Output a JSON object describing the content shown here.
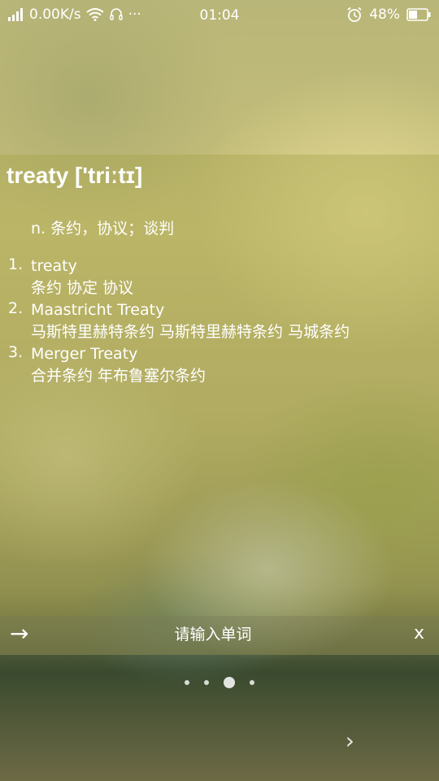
{
  "status_bar": {
    "network_speed": "0.00K/s",
    "more": "···",
    "time": "01:04",
    "battery": "48%"
  },
  "dictionary": {
    "headword": "treaty ['triːtɪ]",
    "definition": "n. 条约，协议；谈判",
    "phrases": [
      {
        "number": "1.",
        "term": "treaty",
        "translation": "条约 协定 协议"
      },
      {
        "number": "2.",
        "term": "Maastricht Treaty",
        "translation": "马斯特里赫特条约 马斯特里赫特条约 马城条约"
      },
      {
        "number": "3.",
        "term": "Merger Treaty",
        "translation": "合并条约 年布鲁塞尔条约"
      }
    ]
  },
  "search_bar": {
    "arrow_label": "→",
    "placeholder": "请输入单词",
    "close_label": "x"
  },
  "pager": {
    "dots": 4,
    "active_index": 2,
    "next_label": "›"
  }
}
